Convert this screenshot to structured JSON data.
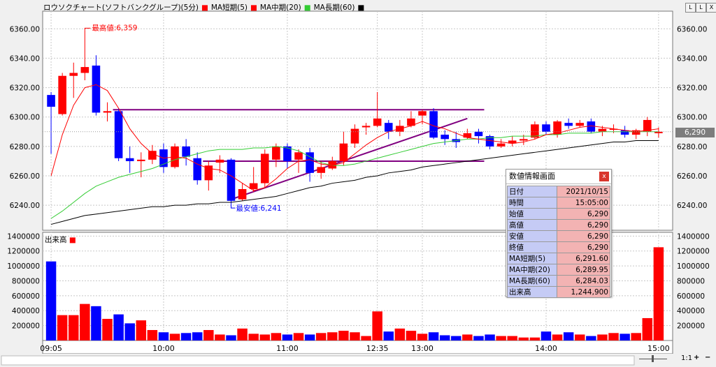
{
  "chart_data": {
    "type": "candlestick",
    "title": "ロウソクチャート(ソフトバンクグループ)(5分)",
    "legend": [
      "MA短期(5)",
      "MA中期(20)",
      "MA長期(60)"
    ],
    "ylim": [
      6223,
      6372
    ],
    "yticks": [
      6240,
      6260,
      6280,
      6300,
      6320,
      6340,
      6360
    ],
    "ytick_labels": [
      "6240.00",
      "6260.00",
      "6280.00",
      "6300.00",
      "6320.00",
      "6340.00",
      "6360.00"
    ],
    "x_labels": [
      "09:05",
      "10:00",
      "11:00",
      "12:35",
      "13:00",
      "14:00",
      "15:00"
    ],
    "x_label_index": [
      0,
      10,
      21,
      29,
      33,
      44,
      54
    ],
    "candles": [
      [
        6315,
        6307,
        6317,
        6275
      ],
      [
        6302,
        6328,
        6330,
        6301
      ],
      [
        6328,
        6330,
        6337,
        6313
      ],
      [
        6330,
        6334,
        6359,
        6325
      ],
      [
        6335,
        6303,
        6342,
        6301
      ],
      [
        6303,
        6304,
        6310,
        6297
      ],
      [
        6304,
        6272,
        6306,
        6270
      ],
      [
        6272,
        6270,
        6280,
        6262
      ],
      [
        6270,
        6271,
        6276,
        6259
      ],
      [
        6271,
        6277,
        6281,
        6268
      ],
      [
        6278,
        6266,
        6282,
        6262
      ],
      [
        6266,
        6280,
        6282,
        6265
      ],
      [
        6280,
        6273,
        6285,
        6267
      ],
      [
        6272,
        6257,
        6276,
        6254
      ],
      [
        6257,
        6267,
        6270,
        6250
      ],
      [
        6269,
        6271,
        6274,
        6262
      ],
      [
        6271,
        6243,
        6272,
        6241
      ],
      [
        6244,
        6251,
        6255,
        6243
      ],
      [
        6251,
        6255,
        6266,
        6249
      ],
      [
        6255,
        6275,
        6278,
        6252
      ],
      [
        6271,
        6280,
        6282,
        6266
      ],
      [
        6280,
        6270,
        6282,
        6265
      ],
      [
        6271,
        6276,
        6278,
        6262
      ],
      [
        6276,
        6262,
        6279,
        6256
      ],
      [
        6262,
        6266,
        6270,
        6258
      ],
      [
        6265,
        6270,
        6273,
        6264
      ],
      [
        6270,
        6282,
        6290,
        6267
      ],
      [
        6282,
        6292,
        6295,
        6279
      ],
      [
        6293,
        6294,
        6296,
        6288
      ],
      [
        6294,
        6299,
        6317,
        6293
      ],
      [
        6296,
        6290,
        6298,
        6285
      ],
      [
        6290,
        6294,
        6298,
        6287
      ],
      [
        6294,
        6299,
        6304,
        6293
      ],
      [
        6301,
        6304,
        6305,
        6295
      ],
      [
        6304,
        6286,
        6306,
        6285
      ],
      [
        6288,
        6285,
        6291,
        6281
      ],
      [
        6285,
        6283,
        6290,
        6279
      ],
      [
        6286,
        6289,
        6292,
        6285
      ],
      [
        6290,
        6287,
        6292,
        6282
      ],
      [
        6287,
        6280,
        6288,
        6278
      ],
      [
        6280,
        6282,
        6285,
        6279
      ],
      [
        6282,
        6284,
        6287,
        6280
      ],
      [
        6284,
        6285,
        6288,
        6281
      ],
      [
        6286,
        6295,
        6297,
        6285
      ],
      [
        6295,
        6290,
        6297,
        6288
      ],
      [
        6288,
        6297,
        6298,
        6286
      ],
      [
        6296,
        6294,
        6299,
        6292
      ],
      [
        6294,
        6296,
        6298,
        6293
      ],
      [
        6297,
        6290,
        6299,
        6289
      ],
      [
        6290,
        6292,
        6294,
        6287
      ],
      [
        6292,
        6292,
        6295,
        6289
      ],
      [
        6291,
        6288,
        6294,
        6286
      ],
      [
        6288,
        6291,
        6292,
        6285
      ],
      [
        6290,
        6298,
        6300,
        6287
      ],
      [
        6289,
        6290,
        6293,
        6286
      ]
    ],
    "ma_short": [
      6260,
      6288,
      6308,
      6320,
      6322,
      6318,
      6306,
      6292,
      6282,
      6275,
      6272,
      6273,
      6272,
      6268,
      6265,
      6264,
      6260,
      6255,
      6250,
      6252,
      6258,
      6265,
      6270,
      6271,
      6268,
      6267,
      6269,
      6275,
      6281,
      6286,
      6290,
      6292,
      6294,
      6297,
      6294,
      6292,
      6289,
      6286,
      6285,
      6284,
      6283,
      6282,
      6283,
      6285,
      6288,
      6289,
      6291,
      6293,
      6294,
      6293,
      6292,
      6291,
      6290,
      6291,
      6292
    ],
    "ma_mid": [
      6231,
      6236,
      6242,
      6248,
      6253,
      6256,
      6259,
      6261,
      6263,
      6265,
      6268,
      6271,
      6273,
      6275,
      6277,
      6278,
      6278,
      6278,
      6279,
      6279,
      6280,
      6279,
      6277,
      6273,
      6269,
      6267,
      6267,
      6268,
      6270,
      6272,
      6274,
      6276,
      6278,
      6280,
      6282,
      6283,
      6284,
      6285,
      6285,
      6286,
      6286,
      6287,
      6287,
      6287,
      6288,
      6288,
      6289,
      6289,
      6289,
      6290,
      6290,
      6290,
      6290,
      6290,
      6290
    ],
    "ma_long": [
      6227,
      6229,
      6231,
      6233,
      6234,
      6235,
      6236,
      6237,
      6238,
      6239,
      6239,
      6240,
      6240,
      6241,
      6241,
      6242,
      6242,
      6243,
      6244,
      6245,
      6246,
      6248,
      6250,
      6252,
      6253,
      6255,
      6256,
      6257,
      6259,
      6260,
      6262,
      6263,
      6264,
      6266,
      6267,
      6268,
      6269,
      6270,
      6271,
      6272,
      6273,
      6274,
      6275,
      6276,
      6277,
      6278,
      6279,
      6280,
      6281,
      6282,
      6283,
      6283,
      6284,
      6284,
      6284
    ],
    "resistance": {
      "price": 6305,
      "from": 6,
      "to": 38
    },
    "support": {
      "price": 6270,
      "from": 14,
      "to": 38
    },
    "trendline": {
      "from": [
        16,
        6244
      ],
      "to": [
        37,
        6299
      ]
    },
    "max_label": "最高値:6,359",
    "max_index": 3,
    "max_value": 6359,
    "min_label": "最安値:6,241",
    "min_index": 16,
    "min_value": 6241,
    "last_price_label": "6,290",
    "last_price": 6290,
    "volume_label": "出来高",
    "volume_ylim": [
      0,
      1450000
    ],
    "volume_yticks": [
      200000,
      400000,
      600000,
      800000,
      1000000,
      1200000,
      1400000
    ],
    "volume_ytick_labels": [
      "200000",
      "400000",
      "600000",
      "800000",
      "1000000",
      "1200000",
      "1400000"
    ],
    "volume": [
      1060000,
      340000,
      340000,
      490000,
      460000,
      290000,
      350000,
      230000,
      270000,
      140000,
      110000,
      90000,
      100000,
      110000,
      140000,
      80000,
      70000,
      160000,
      90000,
      80000,
      100000,
      80000,
      100000,
      80000,
      100000,
      110000,
      130000,
      110000,
      60000,
      390000,
      120000,
      160000,
      130000,
      90000,
      110000,
      70000,
      60000,
      80000,
      60000,
      80000,
      60000,
      60000,
      40000,
      40000,
      120000,
      80000,
      110000,
      80000,
      60000,
      80000,
      100000,
      90000,
      100000,
      300000,
      1250000
    ]
  },
  "ui": {
    "title_buttons": [
      "L",
      "L",
      "X"
    ],
    "price_tag": "6,290",
    "info_panel": {
      "title": "数値情報画面",
      "close": "x",
      "rows": [
        {
          "k": "日付",
          "v": "2021/10/15"
        },
        {
          "k": "時間",
          "v": "15:05:00"
        },
        {
          "k": "始値",
          "v": "6,290"
        },
        {
          "k": "高値",
          "v": "6,290"
        },
        {
          "k": "安値",
          "v": "6,290"
        },
        {
          "k": "終値",
          "v": "6,290"
        },
        {
          "k": "MA短期(5)",
          "v": "6,291.60"
        },
        {
          "k": "MA中期(20)",
          "v": "6,289.95"
        },
        {
          "k": "MA長期(60)",
          "v": "6,284.03"
        },
        {
          "k": "出来高",
          "v": "1,244,900"
        }
      ]
    },
    "scroll": {
      "ratio": "1:1",
      "plus": "+",
      "minus": "−"
    }
  },
  "colors": {
    "up": "#ff0000",
    "down": "#0000ff",
    "ma_short": "#ff0000",
    "ma_mid": "#33cc33",
    "ma_long": "#000000",
    "hline": "#800080",
    "grid": "#c8c8c8"
  }
}
